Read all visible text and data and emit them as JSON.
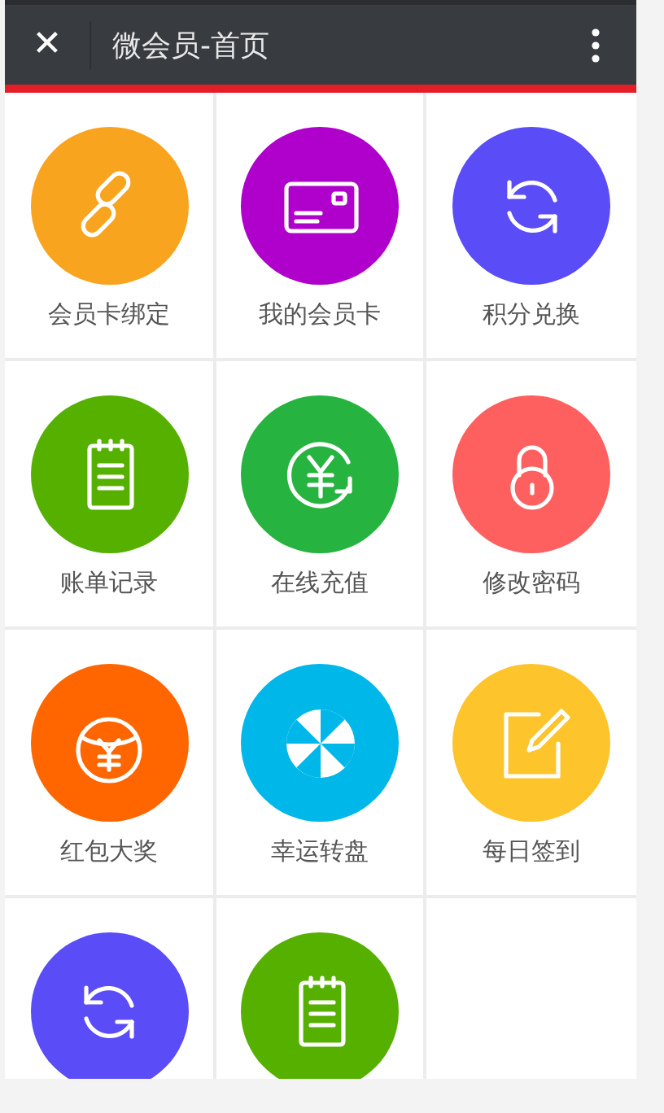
{
  "header": {
    "close_icon": "✕",
    "title": "微会员-首页"
  },
  "menu": [
    {
      "label": "会员卡绑定",
      "kind": "link",
      "color": "#f9a41f"
    },
    {
      "label": "我的会员卡",
      "kind": "card",
      "color": "#b000cc"
    },
    {
      "label": "积分兑换",
      "kind": "exchange",
      "color": "#5a4cf7"
    },
    {
      "label": "账单记录",
      "kind": "notepad",
      "color": "#56b000"
    },
    {
      "label": "在线充值",
      "kind": "recharge",
      "color": "#27b33f"
    },
    {
      "label": "修改密码",
      "kind": "lock",
      "color": "#fe6060"
    },
    {
      "label": "红包大奖",
      "kind": "packet",
      "color": "#ff6600"
    },
    {
      "label": "幸运转盘",
      "kind": "wheel",
      "color": "#00b7e9"
    },
    {
      "label": "每日签到",
      "kind": "sign",
      "color": "#fdc42b"
    },
    {
      "kind": "exchange",
      "color": "#5a4cf7"
    },
    {
      "kind": "notepad",
      "color": "#56b000"
    }
  ]
}
